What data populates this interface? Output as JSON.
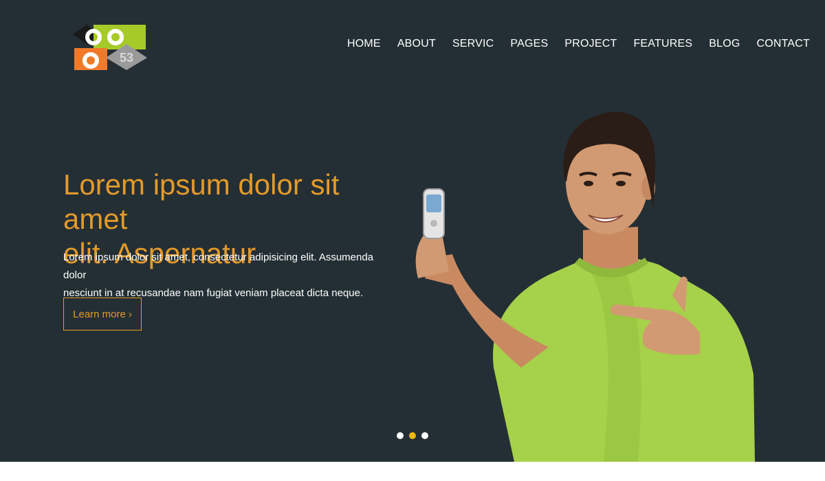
{
  "brand": {
    "logo_text": "53",
    "colors": {
      "orange": "#f07a2a",
      "green": "#a6cb29",
      "black": "#1a1a1a",
      "gray": "#9a9a9a"
    }
  },
  "nav": {
    "items": [
      {
        "label": "HOME"
      },
      {
        "label": "ABOUT"
      },
      {
        "label": "SERVIC"
      },
      {
        "label": "PAGES"
      },
      {
        "label": "PROJECT"
      },
      {
        "label": "FEATURES"
      },
      {
        "label": "BLOG"
      },
      {
        "label": "CONTACT"
      }
    ]
  },
  "hero": {
    "headline_line1": "Lorem ipsum dolor sit amet",
    "headline_line2": "elit. Aspernatur",
    "body_line1": "Lorem ipsum dolor sit amet, consectetur adipisicing elit. Assumenda dolor",
    "body_line2": "nesciunt in at recusandae nam fugiat veniam placeat dicta neque.",
    "cta_label": "Learn more",
    "cta_icon": "chevron-right-icon"
  },
  "carousel": {
    "slide_count": 3,
    "active_slide": 2
  },
  "colors": {
    "background": "#242f35",
    "accent": "#e39a2a",
    "dot_active": "#f1b90f",
    "shirt": "#a6d14a"
  }
}
